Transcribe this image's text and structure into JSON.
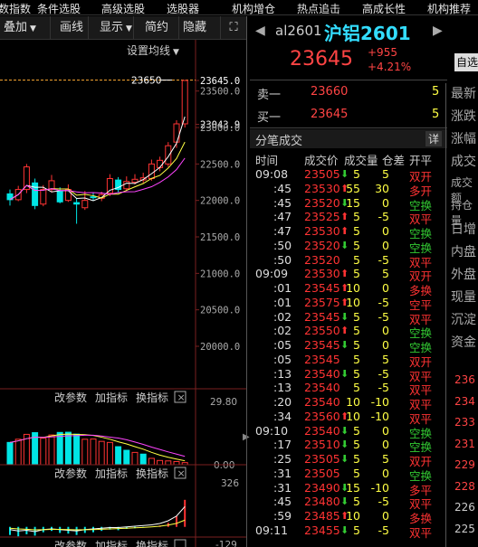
{
  "menu": [
    "数指数",
    "条件选股",
    "高级选股",
    "选股器",
    "机构增仓",
    "热点追击",
    "高成长性",
    "机构推荐"
  ],
  "toolbar": {
    "overlay": "叠加",
    "draw": "画线",
    "display": "显示",
    "simple": "简约",
    "hide": "隐藏"
  },
  "chart": {
    "setting_label": "设置均线",
    "price_marker": "23650",
    "axis_labels": [
      "23645.0",
      "23500.0",
      "23043.9",
      "23000.0",
      "22500.0",
      "22000.0",
      "21500.0",
      "21000.0",
      "20500.0",
      "20000.0"
    ],
    "sub1": {
      "labels": [
        "改参数",
        "加指标",
        "换指标"
      ],
      "top": "29.80",
      "bottom": "0.00"
    },
    "sub2": {
      "labels": [
        "改参数",
        "加指标",
        "换指标"
      ],
      "top": "326",
      "bottom": "-129"
    },
    "sub3": {
      "labels": [
        "改参数",
        "加指标",
        "换指标"
      ]
    },
    "candles": [
      {
        "o": 22090,
        "c": 22010,
        "h": 22150,
        "l": 21930
      },
      {
        "o": 22010,
        "c": 22150,
        "h": 22200,
        "l": 21990
      },
      {
        "o": 22150,
        "c": 22460,
        "h": 22500,
        "l": 22100
      },
      {
        "o": 22240,
        "c": 21930,
        "h": 22300,
        "l": 21880
      },
      {
        "o": 21950,
        "c": 22150,
        "h": 22210,
        "l": 21920
      },
      {
        "o": 22150,
        "c": 22270,
        "h": 22350,
        "l": 22110
      },
      {
        "o": 22120,
        "c": 21980,
        "h": 22180,
        "l": 21960
      },
      {
        "o": 22000,
        "c": 22150,
        "h": 22220,
        "l": 21980
      },
      {
        "o": 21970,
        "c": 21950,
        "h": 22030,
        "l": 21680
      },
      {
        "o": 21900,
        "c": 22000,
        "h": 22130,
        "l": 21870
      },
      {
        "o": 22050,
        "c": 22040,
        "h": 22110,
        "l": 22000
      },
      {
        "o": 22030,
        "c": 22080,
        "h": 22120,
        "l": 21990
      },
      {
        "o": 22100,
        "c": 22300,
        "h": 22360,
        "l": 22060
      },
      {
        "o": 22280,
        "c": 22150,
        "h": 22320,
        "l": 22100
      },
      {
        "o": 22160,
        "c": 22260,
        "h": 22330,
        "l": 22130
      },
      {
        "o": 22250,
        "c": 22290,
        "h": 22360,
        "l": 22220
      },
      {
        "o": 22280,
        "c": 22310,
        "h": 22380,
        "l": 22240
      },
      {
        "o": 22300,
        "c": 22500,
        "h": 22560,
        "l": 22270
      },
      {
        "o": 22450,
        "c": 22550,
        "h": 22600,
        "l": 22400
      },
      {
        "o": 22500,
        "c": 22750,
        "h": 22800,
        "l": 22460
      },
      {
        "o": 22800,
        "c": 23050,
        "h": 23100,
        "l": 22720
      },
      {
        "o": 23050,
        "c": 23645,
        "h": 23650,
        "l": 23000
      }
    ],
    "sub1_bars": [
      {
        "v": 10.5,
        "up": false
      },
      {
        "v": 12.0,
        "up": true
      },
      {
        "v": 14.3,
        "up": true
      },
      {
        "v": 15.1,
        "up": false
      },
      {
        "v": 12.5,
        "up": true
      },
      {
        "v": 14.0,
        "up": true
      },
      {
        "v": 15.2,
        "up": false
      },
      {
        "v": 15.3,
        "up": false
      },
      {
        "v": 14.4,
        "up": false
      },
      {
        "v": 12.0,
        "up": true
      },
      {
        "v": 12.1,
        "up": true
      },
      {
        "v": 11.0,
        "up": true
      },
      {
        "v": 10.5,
        "up": true
      },
      {
        "v": 8.5,
        "up": false
      },
      {
        "v": 6.8,
        "up": false
      },
      {
        "v": 5.8,
        "up": true
      },
      {
        "v": 5.0,
        "up": false
      },
      {
        "v": 3.0,
        "up": true
      },
      {
        "v": 2.0,
        "up": true
      },
      {
        "v": 1.8,
        "up": true
      },
      {
        "v": 1.5,
        "up": true
      },
      {
        "v": 1.0,
        "up": true
      }
    ]
  },
  "quote": {
    "code": "al2601",
    "name": "沪铝2601",
    "price": "23645",
    "change": "+955",
    "pct": "+4.21%",
    "btn": "自选",
    "sell_label": "卖一",
    "sell_price": "23660",
    "sell_vol": "5",
    "buy_label": "买一",
    "buy_price": "23645",
    "buy_vol": "5",
    "side_labels": [
      "最新",
      "涨跌",
      "涨幅",
      "成交",
      "成交额",
      "持仓量",
      "日增",
      "内盘",
      "外盘",
      "现量",
      "沉淀",
      "资金"
    ],
    "side_nums": [
      "236",
      "234",
      "233",
      "231",
      "229",
      "228",
      "226",
      "225"
    ]
  },
  "trades": {
    "title": "分笔成交",
    "detail_btn": "详",
    "headers": [
      "时间",
      "成交价",
      "成交量",
      "仓差",
      "开平"
    ],
    "rows": [
      {
        "t": "09:08",
        "p": "23505",
        "d": "down",
        "v": "5",
        "oi": "5",
        "k": "双开",
        "kc": "r"
      },
      {
        "t": ":45",
        "p": "23530",
        "d": "up",
        "v": "55",
        "oi": "30",
        "k": "多开",
        "kc": "r"
      },
      {
        "t": ":45",
        "p": "23520",
        "d": "down",
        "v": "15",
        "oi": "0",
        "k": "空换",
        "kc": "g"
      },
      {
        "t": ":47",
        "p": "23525",
        "d": "up",
        "v": "5",
        "oi": "-5",
        "k": "双平",
        "kc": "r"
      },
      {
        "t": ":47",
        "p": "23530",
        "d": "up",
        "v": "5",
        "oi": "0",
        "k": "空换",
        "kc": "g"
      },
      {
        "t": ":50",
        "p": "23520",
        "d": "down",
        "v": "5",
        "oi": "0",
        "k": "空换",
        "kc": "g"
      },
      {
        "t": ":50",
        "p": "23520",
        "d": "",
        "v": "5",
        "oi": "-5",
        "k": "双平",
        "kc": "r"
      },
      {
        "t": "09:09",
        "p": "23530",
        "d": "up",
        "v": "5",
        "oi": "5",
        "k": "双开",
        "kc": "r"
      },
      {
        "t": ":01",
        "p": "23545",
        "d": "up",
        "v": "10",
        "oi": "0",
        "k": "多换",
        "kc": "r"
      },
      {
        "t": ":01",
        "p": "23575",
        "d": "up",
        "v": "10",
        "oi": "-5",
        "k": "空平",
        "kc": "r"
      },
      {
        "t": ":02",
        "p": "23545",
        "d": "down",
        "v": "5",
        "oi": "-5",
        "k": "双平",
        "kc": "r"
      },
      {
        "t": ":02",
        "p": "23550",
        "d": "up",
        "v": "5",
        "oi": "0",
        "k": "空换",
        "kc": "g"
      },
      {
        "t": ":05",
        "p": "23545",
        "d": "down",
        "v": "5",
        "oi": "0",
        "k": "空换",
        "kc": "g"
      },
      {
        "t": ":05",
        "p": "23545",
        "d": "",
        "v": "5",
        "oi": "5",
        "k": "双开",
        "kc": "r"
      },
      {
        "t": ":13",
        "p": "23540",
        "d": "down",
        "v": "5",
        "oi": "-5",
        "k": "双平",
        "kc": "r"
      },
      {
        "t": ":13",
        "p": "23540",
        "d": "",
        "v": "5",
        "oi": "-5",
        "k": "双平",
        "kc": "r"
      },
      {
        "t": ":20",
        "p": "23540",
        "d": "",
        "v": "10",
        "oi": "-10",
        "k": "双平",
        "kc": "r"
      },
      {
        "t": ":34",
        "p": "23560",
        "d": "up",
        "v": "10",
        "oi": "-10",
        "k": "双平",
        "kc": "r"
      },
      {
        "t": "09:10",
        "p": "23540",
        "d": "down",
        "v": "5",
        "oi": "0",
        "k": "空换",
        "kc": "g"
      },
      {
        "t": ":17",
        "p": "23510",
        "d": "down",
        "v": "5",
        "oi": "0",
        "k": "空换",
        "kc": "g"
      },
      {
        "t": ":25",
        "p": "23505",
        "d": "down",
        "v": "5",
        "oi": "5",
        "k": "双开",
        "kc": "r"
      },
      {
        "t": ":31",
        "p": "23505",
        "d": "",
        "v": "5",
        "oi": "0",
        "k": "空换",
        "kc": "g"
      },
      {
        "t": ":31",
        "p": "23490",
        "d": "down",
        "v": "15",
        "oi": "-10",
        "k": "多平",
        "kc": "r"
      },
      {
        "t": ":45",
        "p": "23480",
        "d": "down",
        "v": "5",
        "oi": "-5",
        "k": "双平",
        "kc": "r"
      },
      {
        "t": ":59",
        "p": "23485",
        "d": "up",
        "v": "10",
        "oi": "0",
        "k": "多换",
        "kc": "r"
      },
      {
        "t": "09:11",
        "p": "23455",
        "d": "down",
        "v": "5",
        "oi": "-5",
        "k": "双平",
        "kc": "r"
      }
    ]
  },
  "colors": {
    "up": "#ff3333",
    "down": "#00e5e5",
    "green": "#33cc33",
    "yellow": "#ffff44",
    "cyan": "#33ddff",
    "bg": "#000000"
  }
}
